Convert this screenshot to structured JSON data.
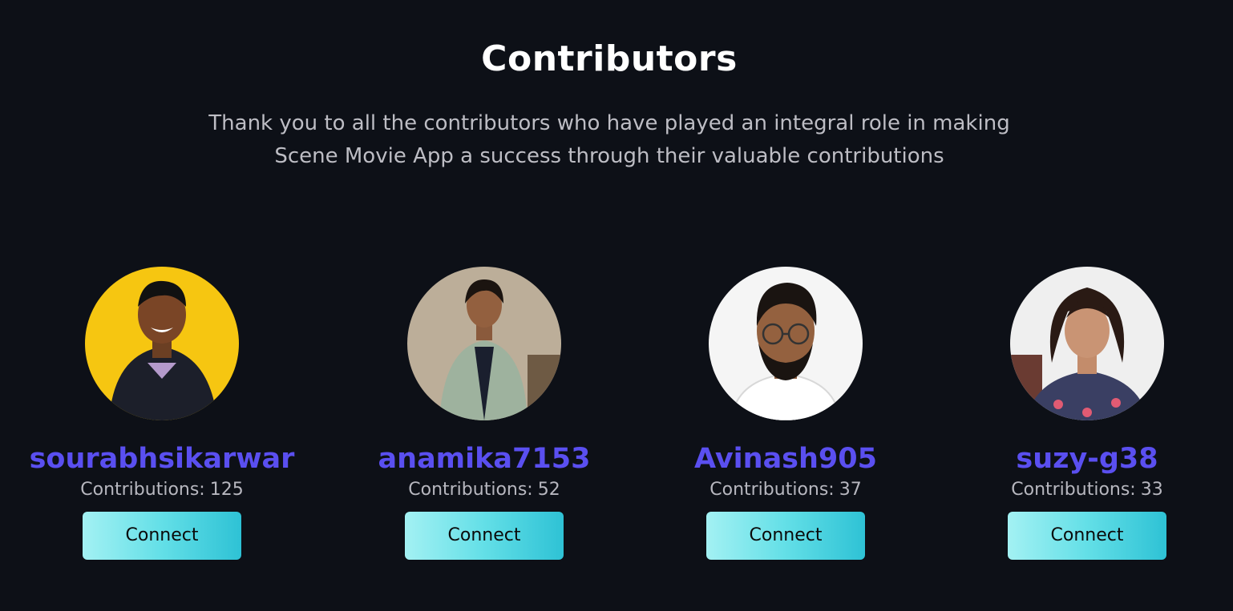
{
  "header": {
    "title": "Contributors",
    "subtitle_line1": "Thank you to all the contributors who have played an integral role in making",
    "subtitle_line2": "Scene Movie App a success through their valuable contributions"
  },
  "contributors": [
    {
      "username": "sourabhsikarwar",
      "contributions_label": "Contributions:",
      "contributions": "125",
      "button_label": "Connect",
      "avatar_bg": "#f6c611"
    },
    {
      "username": "anamika7153",
      "contributions_label": "Contributions:",
      "contributions": "52",
      "button_label": "Connect",
      "avatar_bg": "#bcae99"
    },
    {
      "username": "Avinash905",
      "contributions_label": "Contributions:",
      "contributions": "37",
      "button_label": "Connect",
      "avatar_bg": "#f5f5f5"
    },
    {
      "username": "suzy-g38",
      "contributions_label": "Contributions:",
      "contributions": "33",
      "button_label": "Connect",
      "avatar_bg": "#efefef"
    }
  ],
  "colors": {
    "background": "#0d1017",
    "title": "#ffffff",
    "username": "#5a4ff0",
    "button_gradient_start": "#a3f1f3",
    "button_gradient_end": "#2ec2d5"
  }
}
